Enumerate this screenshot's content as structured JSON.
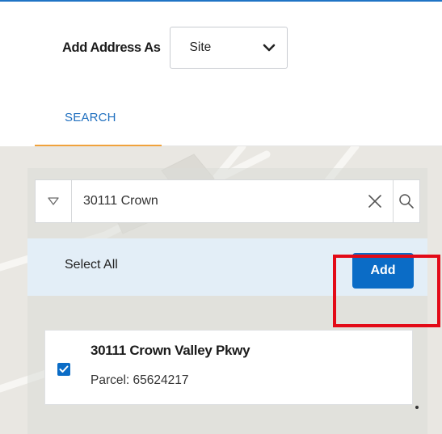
{
  "header": {
    "add_address_label": "Add Address As",
    "address_type_selected": "Site"
  },
  "tabs": [
    {
      "label": "SEARCH",
      "active": true
    }
  ],
  "search": {
    "value": "30111 Crown",
    "icons": {
      "filter": "triangle-down-icon",
      "clear": "close-icon",
      "search": "search-icon"
    }
  },
  "results_bar": {
    "select_all_label": "Select All",
    "add_button_label": "Add"
  },
  "results": [
    {
      "title": "30111 Crown Valley Pkwy",
      "subtitle": "Parcel: 65624217",
      "checked": true
    }
  ],
  "colors": {
    "accent": "#0b6cc6",
    "tab_text": "#1f6fbf",
    "tab_underline": "#f0a23c",
    "highlight": "#e30a17",
    "select_bar_bg": "#e3eef7"
  }
}
